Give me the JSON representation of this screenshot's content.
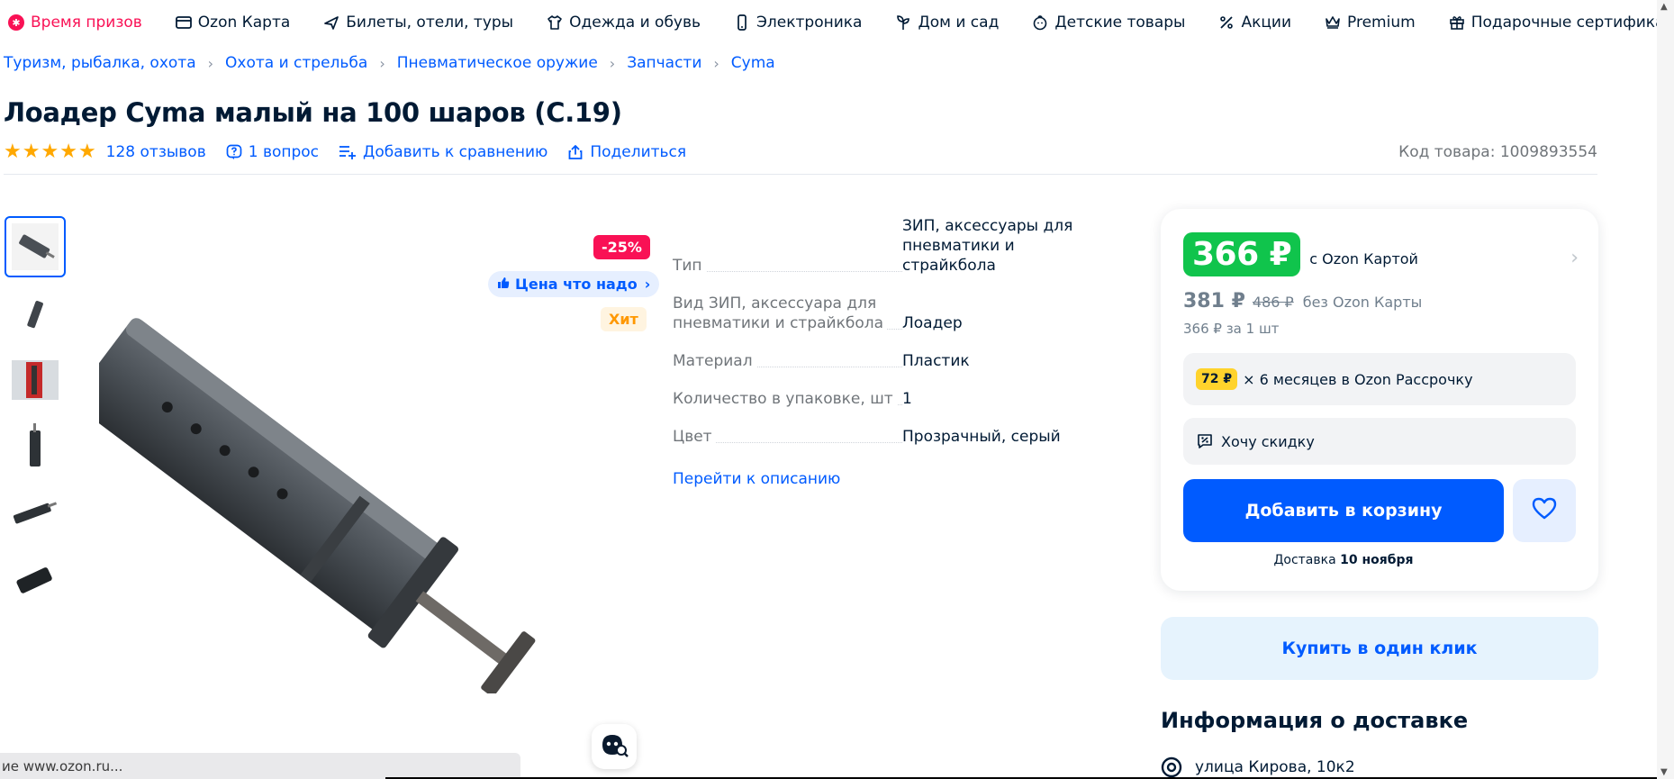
{
  "topnav": {
    "items": [
      {
        "label": "Время призов",
        "icon": "prize-icon"
      },
      {
        "label": "Ozon Карта",
        "icon": "card-icon"
      },
      {
        "label": "Билеты, отели, туры",
        "icon": "plane-icon"
      },
      {
        "label": "Одежда и обувь",
        "icon": "clothes-icon"
      },
      {
        "label": "Электроника",
        "icon": "phone-icon"
      },
      {
        "label": "Дом и сад",
        "icon": "plant-icon"
      },
      {
        "label": "Детские товары",
        "icon": "baby-icon"
      },
      {
        "label": "Акции",
        "icon": "percent-icon"
      },
      {
        "label": "Premium",
        "icon": "crown-icon"
      },
      {
        "label": "Подарочные сертификаты",
        "icon": "gift-icon"
      }
    ]
  },
  "breadcrumb": [
    "Туризм, рыбалка, охота",
    "Охота и стрельба",
    "Пневматическое оружие",
    "Запчасти",
    "Cyma"
  ],
  "product": {
    "title": "Лоадер Cyma малый на 100 шаров (C.19)",
    "reviews": "128 отзывов",
    "questions": "1 вопрос",
    "compare": "Добавить к сравнению",
    "share": "Поделиться",
    "sku": "Код товара: 1009893554",
    "rating_stars": 5
  },
  "badges": {
    "discount": "-25%",
    "good_price": "Цена что надо",
    "hit": "Хит"
  },
  "specs": [
    {
      "key": "Тип",
      "value": "ЗИП, аксессуары для пневматики и страйкбола"
    },
    {
      "key": "Вид ЗИП, аксессуара для пневматики и страйкбола",
      "value": "Лоадер"
    },
    {
      "key": "Материал",
      "value": "Пластик"
    },
    {
      "key": "Количество в упаковке, шт",
      "value": "1"
    },
    {
      "key": "Цвет",
      "value": "Прозрачный, серый"
    }
  ],
  "specs_link": "Перейти к описанию",
  "price": {
    "card_price": "366 ₽",
    "card_label": "с Ozon Картой",
    "regular_price": "381 ₽",
    "old_price": "486 ₽",
    "regular_label": "без Ozon Карты",
    "per_unit": "366 ₽ за 1 шт",
    "installment_amount": "72 ₽",
    "installment_text": "× 6 месяцев в Ozon Рассрочку",
    "want_discount": "Хочу скидку",
    "add_to_cart": "Добавить в корзину",
    "delivery_prefix": "Доставка",
    "delivery_date": "10 ноября",
    "one_click": "Купить в один клик"
  },
  "delivery_info": {
    "title": "Информация о доставке",
    "address": "улица Кирова, 10к2"
  },
  "statusbar": "ие www.ozon.ru...",
  "colors": {
    "accent": "#005bff",
    "green_price": "#10c44c",
    "discount": "#f91155",
    "star": "#ffa800"
  }
}
